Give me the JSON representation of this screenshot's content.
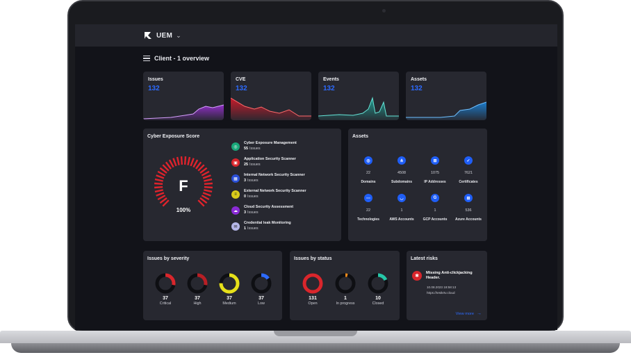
{
  "app": {
    "name": "UEM"
  },
  "header": {
    "title": "Client - 1 overview"
  },
  "stats": [
    {
      "title": "Issues",
      "value": "132",
      "color": "#9b2fd6"
    },
    {
      "title": "CVE",
      "value": "132",
      "color": "#d11a2a"
    },
    {
      "title": "Events",
      "value": "132",
      "color": "#1fa89a"
    },
    {
      "title": "Assets",
      "value": "132",
      "color": "#1b7fd1"
    }
  ],
  "exposure": {
    "title": "Cyber Exposure Score",
    "grade": "F",
    "percent": "100%",
    "categories": [
      {
        "name": "Cyber Exposure Management",
        "count": "55",
        "unit": "Issues",
        "color": "#19a87a",
        "icon": "globe-icon"
      },
      {
        "name": "Application Security Scanner",
        "count": "25",
        "unit": "Issues",
        "color": "#d9262c",
        "icon": "lock-icon"
      },
      {
        "name": "Internal Network Security Scanner",
        "count": "3",
        "unit": "Issues",
        "color": "#2a4fd6",
        "icon": "network-icon"
      },
      {
        "name": "External Network Security Scanner",
        "count": "0",
        "unit": "Issues",
        "color": "#d9cc1a",
        "icon": "server-icon"
      },
      {
        "name": "Cloud Security Assessment",
        "count": "3",
        "unit": "Issues",
        "color": "#8a2bd6",
        "icon": "cloud-icon"
      },
      {
        "name": "Credential leak Monitoring",
        "count": "1",
        "unit": "Issues",
        "color": "#b6b7e8",
        "icon": "key-icon"
      }
    ]
  },
  "assets": {
    "title": "Assets",
    "items": [
      {
        "count": "22",
        "label": "Domains",
        "icon": "globe-icon",
        "glyph": "◎"
      },
      {
        "count": "4508",
        "label": "Subdomains",
        "icon": "subdomain-icon",
        "glyph": "⋔"
      },
      {
        "count": "1075",
        "label": "IP Addresses",
        "icon": "ip-icon",
        "glyph": "⊞"
      },
      {
        "count": "7621",
        "label": "Certificates",
        "icon": "certificate-icon",
        "glyph": "✓"
      },
      {
        "count": "22",
        "label": "Technologies",
        "icon": "technology-icon",
        "glyph": "⋯"
      },
      {
        "count": "1",
        "label": "AWS Accounts",
        "icon": "aws-icon",
        "glyph": "◡"
      },
      {
        "count": "1",
        "label": "GCP Accounts",
        "icon": "google-icon",
        "glyph": "G"
      },
      {
        "count": "536",
        "label": "Azure Accounts",
        "icon": "windows-icon",
        "glyph": "⊞"
      }
    ]
  },
  "severity": {
    "title": "Issues by severity",
    "items": [
      {
        "value": "37",
        "label": "Critical",
        "color": "#d9262c",
        "fraction": 0.28
      },
      {
        "value": "37",
        "label": "High",
        "color": "#b81f25",
        "fraction": 0.28
      },
      {
        "value": "37",
        "label": "Medium",
        "color": "#e6e01a",
        "fraction": 0.75
      },
      {
        "value": "37",
        "label": "Low",
        "color": "#2d6bff",
        "fraction": 0.15
      }
    ]
  },
  "status": {
    "title": "Issues by status",
    "items": [
      {
        "value": "131",
        "label": "Open",
        "color": "#d9262c",
        "fraction": 1.0
      },
      {
        "value": "1",
        "label": "In progress",
        "color": "#f08a1a",
        "fraction": 0.04
      },
      {
        "value": "10",
        "label": "Closed",
        "color": "#26c7a8",
        "fraction": 0.18
      }
    ]
  },
  "risks": {
    "title": "Latest risks",
    "name": "Missing Anti-clickjacking Header.",
    "date": "10.08.2023 18:58:13",
    "url": "https://testkrtv.cloud",
    "view_more": "View more"
  }
}
